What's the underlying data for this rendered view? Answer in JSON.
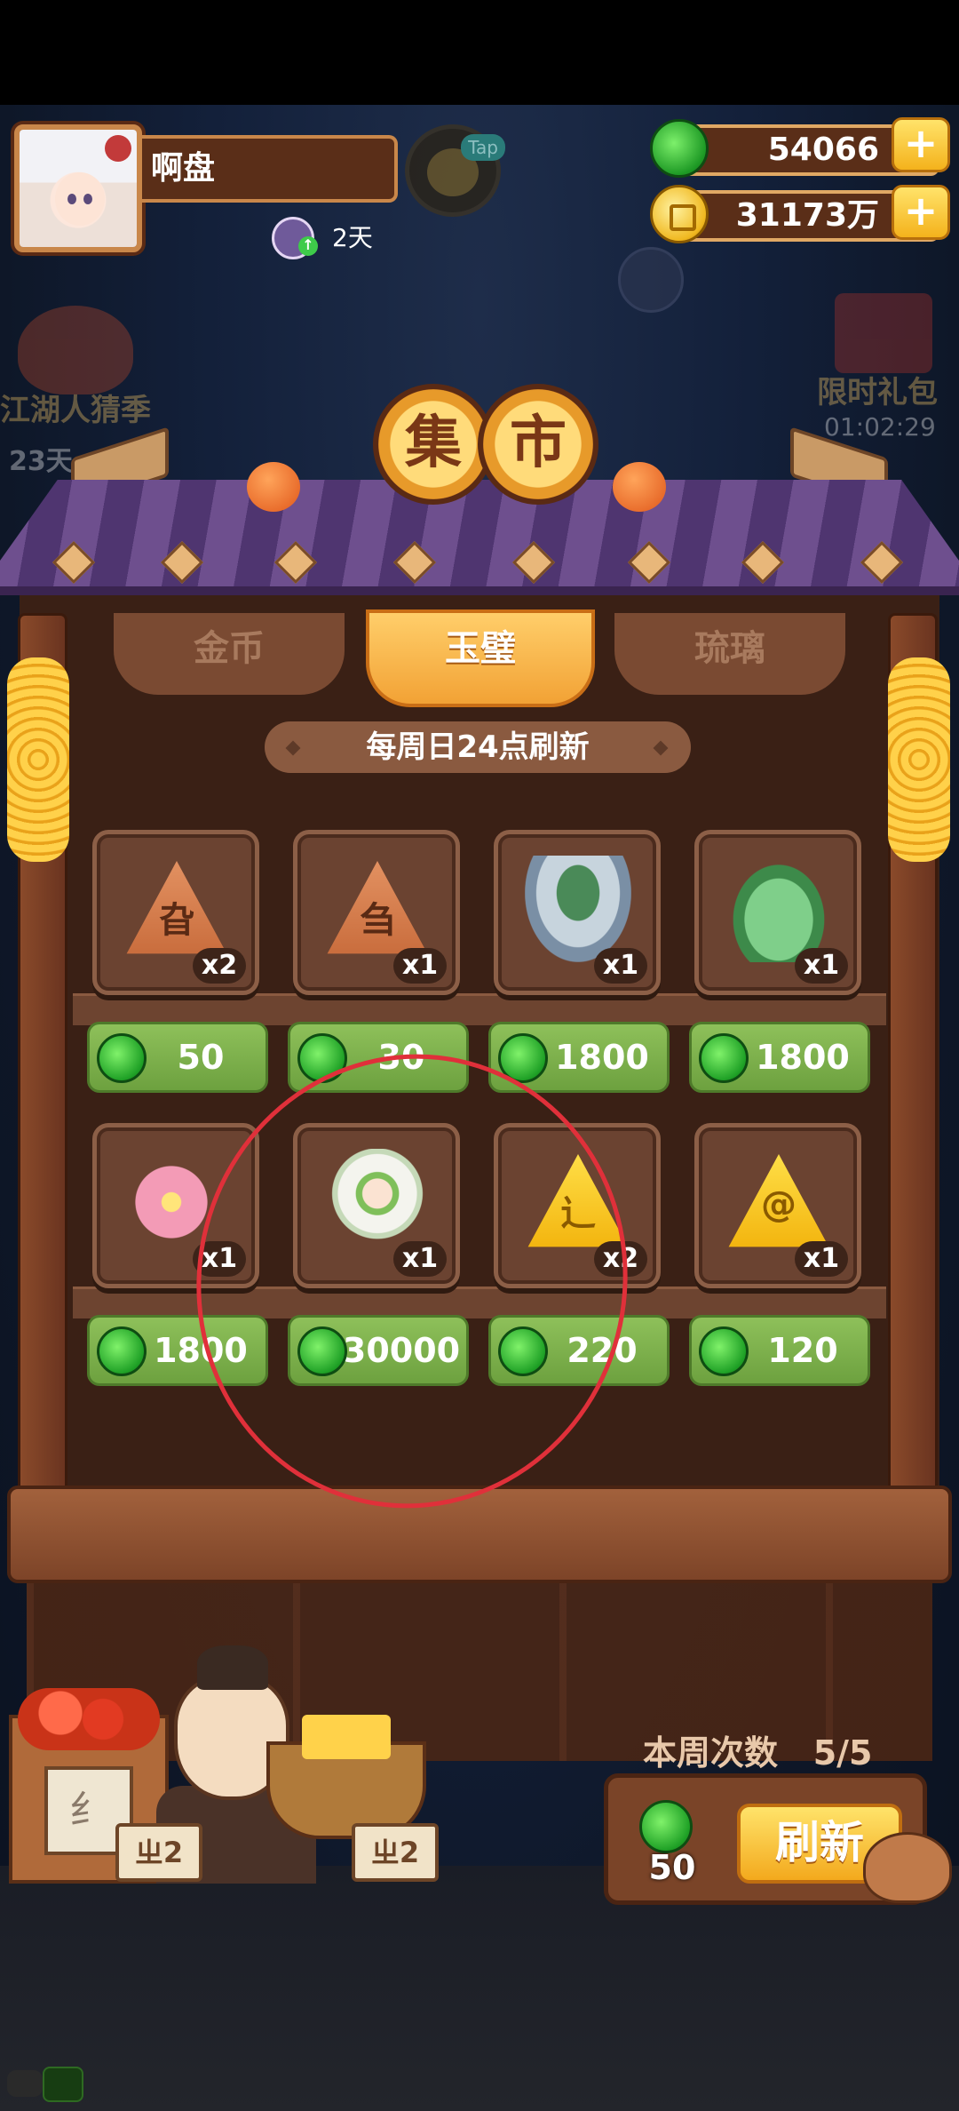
{
  "player": {
    "name": "啊盘",
    "days": "2天"
  },
  "tap_label": "Tap",
  "currency": {
    "jade": "54066",
    "coin": "31173万",
    "plus_glyph": "+"
  },
  "events": {
    "left": {
      "label": "江湖人猜季",
      "timer": "23天"
    },
    "right": {
      "label": "限时礼包",
      "timer": "01:02:29"
    }
  },
  "market": {
    "title_left": "集",
    "title_right": "市",
    "tabs": [
      "金币",
      "玉璧",
      "琉璃"
    ],
    "active_tab": "玉璧",
    "refresh_notice": "每周日24点刷新"
  },
  "items": [
    {
      "art": "brown-triangle",
      "glyph": "旮",
      "qty": "x2",
      "price": "50"
    },
    {
      "art": "brown-triangle",
      "glyph": "刍",
      "qty": "x1",
      "price": "30"
    },
    {
      "art": "jade-bowl",
      "glyph": "",
      "qty": "x1",
      "price": "1800"
    },
    {
      "art": "green-scroll-bag",
      "glyph": "",
      "qty": "x1",
      "price": "1800"
    },
    {
      "art": "pink-flower",
      "glyph": "",
      "qty": "x1",
      "price": "1800"
    },
    {
      "art": "green-hair-doll",
      "glyph": "",
      "qty": "x1",
      "price": "30000"
    },
    {
      "art": "gold-triangle",
      "glyph": "辶",
      "qty": "x2",
      "price": "220"
    },
    {
      "art": "gold-triangle",
      "glyph": "@",
      "qty": "x1",
      "price": "120"
    }
  ],
  "weekly": {
    "label": "本周次数",
    "count": "5/5"
  },
  "refresh": {
    "cost": "50",
    "button": "刷新"
  },
  "stall_tags": [
    "ㄓ2",
    "ㄓ2"
  ],
  "sign_glyph": "纟",
  "colors": {
    "price_green": "#7fb24d",
    "tab_active": "#f2a235",
    "annotation": "#e0303a"
  }
}
